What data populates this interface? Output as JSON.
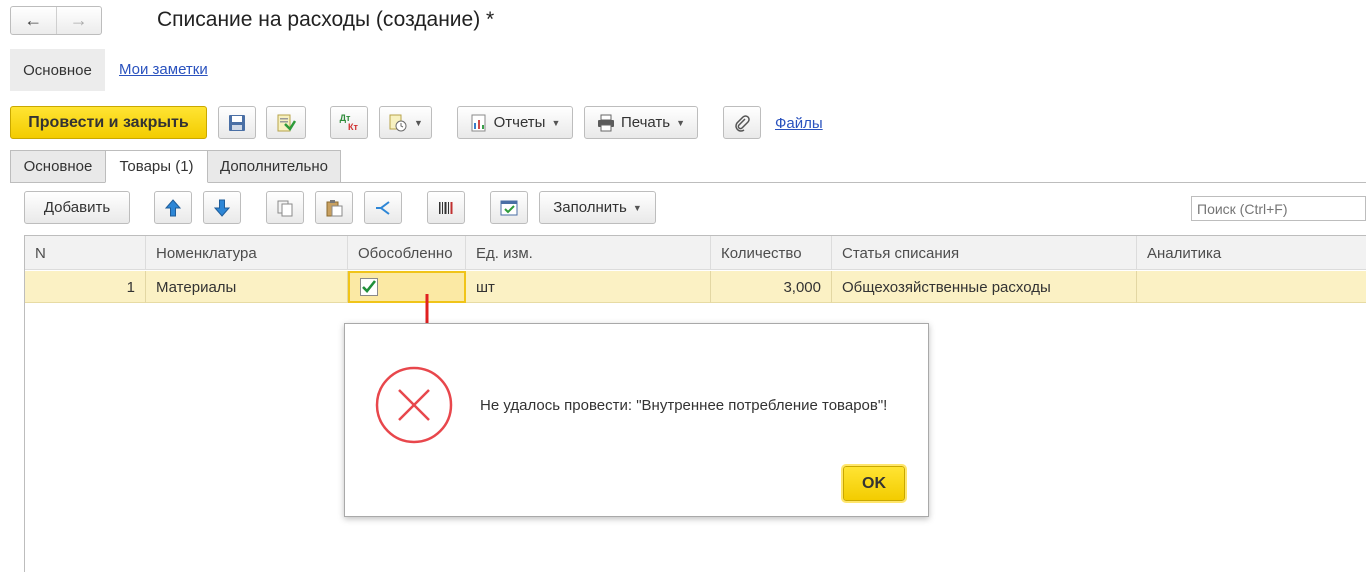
{
  "window": {
    "title": "Списание на расходы (создание) *"
  },
  "nav": {
    "back_icon": "←",
    "forward_icon": "→"
  },
  "form_tabs": {
    "main": "Основное",
    "notes": "Мои заметки"
  },
  "toolbar": {
    "post_close": "Провести и закрыть",
    "dtkt_top": "Дт",
    "dtkt_bottom": "Кт",
    "reports": "Отчеты",
    "print": "Печать",
    "files": "Файлы"
  },
  "doc_tabs": [
    "Основное",
    "Товары (1)",
    "Дополнительно"
  ],
  "table_toolbar": {
    "add": "Добавить",
    "fill": "Заполнить",
    "search_placeholder": "Поиск (Ctrl+F)"
  },
  "table": {
    "headers": [
      "N",
      "Номенклатура",
      "Обособленно",
      "Ед. изм.",
      "Количество",
      "Статья списания",
      "Аналитика"
    ],
    "rows": [
      {
        "n": "1",
        "item": "Материалы",
        "separate": true,
        "unit": "шт",
        "qty": "3,000",
        "article": "Общехозяйственные расходы",
        "analytics": ""
      }
    ]
  },
  "dialog": {
    "message": "Не удалось провести: \"Внутреннее потребление товаров\"!",
    "ok": "OK"
  },
  "colors": {
    "accent_yellow": "#f5cf00",
    "error_red": "#e8474c",
    "annotation_red": "#e02020",
    "link": "#2a52be",
    "row_highlight": "#fbf1c4"
  }
}
